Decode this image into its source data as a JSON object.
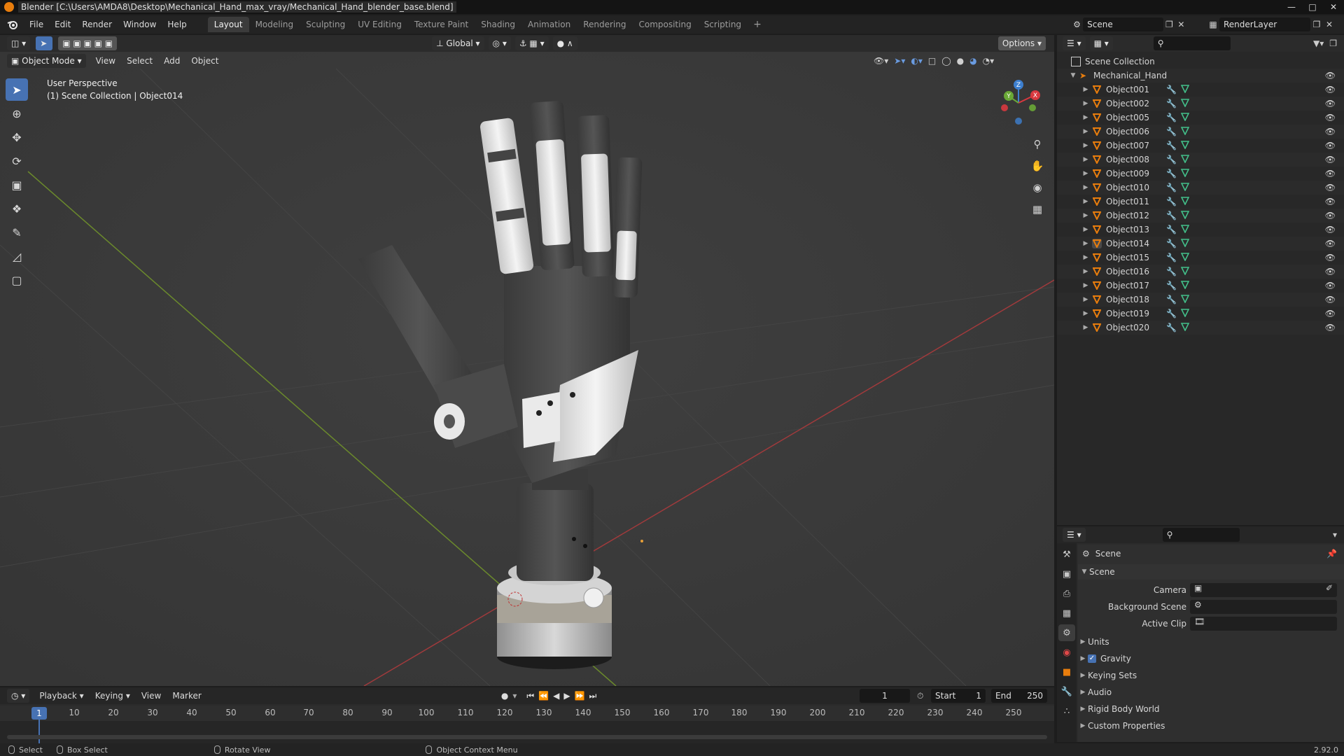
{
  "titlebar": {
    "title": "Blender [C:\\Users\\AMDA8\\Desktop\\Mechanical_Hand_max_vray/Mechanical_Hand_blender_base.blend]"
  },
  "menu": [
    "File",
    "Edit",
    "Render",
    "Window",
    "Help"
  ],
  "workspaces": [
    "Layout",
    "Modeling",
    "Sculpting",
    "UV Editing",
    "Texture Paint",
    "Shading",
    "Animation",
    "Rendering",
    "Compositing",
    "Scripting"
  ],
  "active_workspace": "Layout",
  "scene_name": "Scene",
  "render_layer": "RenderLayer",
  "viewport": {
    "transform_orientation": "Global",
    "options_label": "Options",
    "mode": "Object Mode",
    "menus": [
      "View",
      "Select",
      "Add",
      "Object"
    ],
    "perspective_label": "User Perspective",
    "collection_label": "(1) Scene Collection | Object014",
    "gizmo_axes": {
      "x": "X",
      "y": "Y",
      "z": "Z"
    }
  },
  "timeline": {
    "menus": [
      "Playback",
      "Keying",
      "View",
      "Marker"
    ],
    "current_frame": "1",
    "start_label": "Start",
    "start_value": "1",
    "end_label": "End",
    "end_value": "250",
    "ruler": [
      "1",
      "10",
      "20",
      "30",
      "40",
      "50",
      "60",
      "70",
      "80",
      "90",
      "100",
      "110",
      "120",
      "130",
      "140",
      "150",
      "160",
      "170",
      "180",
      "190",
      "200",
      "210",
      "220",
      "230",
      "240",
      "250"
    ]
  },
  "statusbar": {
    "select": "Select",
    "box_select": "Box Select",
    "rotate_view": "Rotate View",
    "context_menu": "Object Context Menu",
    "version": "2.92.0"
  },
  "outliner": {
    "root": "Scene Collection",
    "collection": "Mechanical_Hand",
    "objects": [
      "Object001",
      "Object002",
      "Object005",
      "Object006",
      "Object007",
      "Object008",
      "Object009",
      "Object010",
      "Object011",
      "Object012",
      "Object013",
      "Object014",
      "Object015",
      "Object016",
      "Object017",
      "Object018",
      "Object019",
      "Object020"
    ],
    "active_object": "Object014"
  },
  "properties": {
    "header": "Scene",
    "panel": "Scene",
    "fields": [
      {
        "label": "Camera"
      },
      {
        "label": "Background Scene"
      },
      {
        "label": "Active Clip"
      }
    ],
    "subpanels": [
      "Units",
      "Gravity",
      "Keying Sets",
      "Audio",
      "Rigid Body World",
      "Custom Properties"
    ],
    "gravity_checked": true
  },
  "colors": {
    "accent": "#4772b3",
    "object_orange": "#e87d0d",
    "mesh_green": "#43c08a",
    "x_axis": "#d8383f",
    "y_axis": "#6aa836",
    "z_axis": "#3d7fcf"
  }
}
